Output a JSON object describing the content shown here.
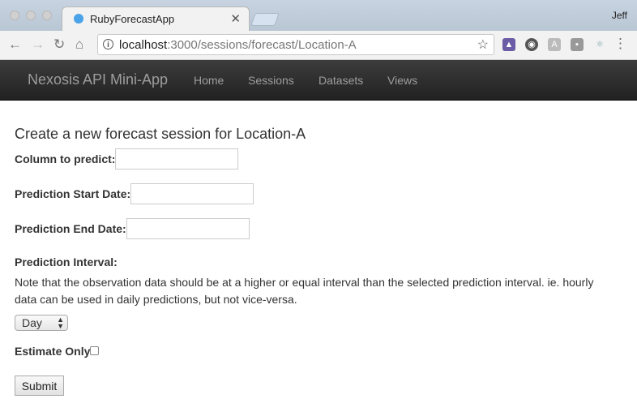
{
  "browser": {
    "tab_title": "RubyForecastApp",
    "profile_name": "Jeff",
    "url_host": "localhost",
    "url_rest": ":3000/sessions/forecast/Location-A",
    "icons": [
      "back-icon",
      "forward-icon",
      "reload-icon",
      "home-icon",
      "info-icon",
      "bookmark-star-icon",
      "extensions",
      "menu-icon"
    ]
  },
  "navbar": {
    "brand": "Nexosis API Mini-App",
    "links": [
      "Home",
      "Sessions",
      "Datasets",
      "Views"
    ]
  },
  "form": {
    "heading": "Create a new forecast session for Location-A",
    "column_label": "Column to predict:",
    "column_value": "",
    "start_label": "Prediction Start Date:",
    "start_value": "",
    "end_label": "Prediction End Date:",
    "end_value": "",
    "interval_label": "Prediction Interval:",
    "interval_note": "Note that the observation data should be at a higher or equal interval than the selected prediction interval. ie. hourly data can be used in daily predictions, but not vice-versa.",
    "interval_selected": "Day",
    "estimate_label": "Estimate Only",
    "estimate_checked": false,
    "submit_label": "Submit"
  },
  "colors": {
    "navbar_bg": "#222222",
    "navbar_text": "#9d9d9d"
  }
}
